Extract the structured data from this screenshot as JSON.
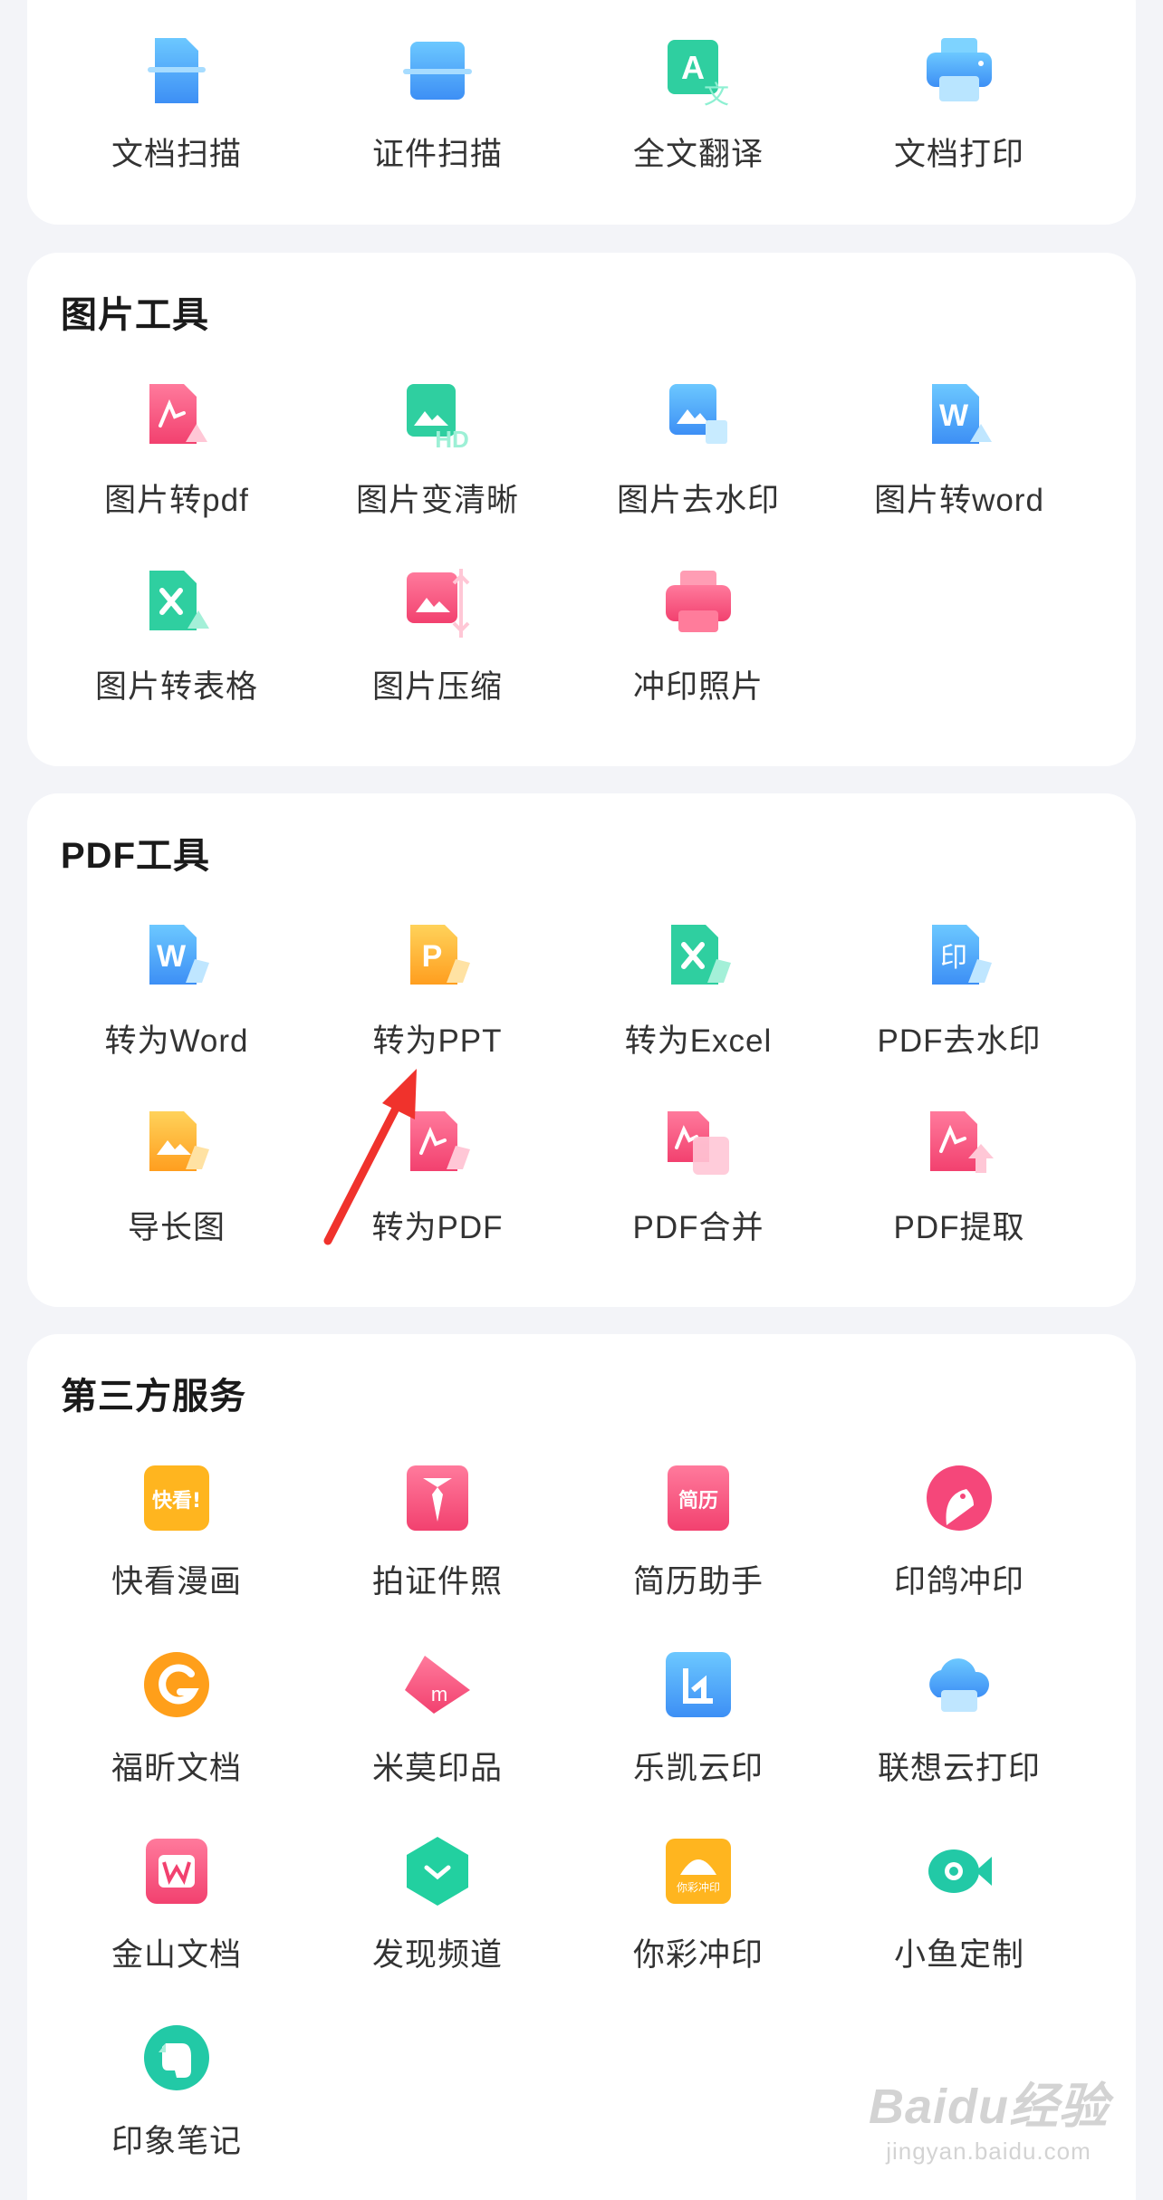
{
  "colors": {
    "page_bg": "#f3f4f8",
    "card_bg": "#ffffff",
    "annotation_arrow": "#f0322c"
  },
  "top_tools": [
    {
      "label": "文档扫描",
      "icon": "document-scan-icon"
    },
    {
      "label": "证件扫描",
      "icon": "id-scan-icon"
    },
    {
      "label": "全文翻译",
      "icon": "translate-icon"
    },
    {
      "label": "文档打印",
      "icon": "printer-icon"
    }
  ],
  "image_tools": {
    "title": "图片工具",
    "items": [
      {
        "label": "图片转pdf",
        "icon": "image-to-pdf-icon"
      },
      {
        "label": "图片变清晰",
        "icon": "image-hd-icon"
      },
      {
        "label": "图片去水印",
        "icon": "image-remove-watermark-icon"
      },
      {
        "label": "图片转word",
        "icon": "image-to-word-icon"
      },
      {
        "label": "图片转表格",
        "icon": "image-to-excel-icon"
      },
      {
        "label": "图片压缩",
        "icon": "image-compress-icon"
      },
      {
        "label": "冲印照片",
        "icon": "photo-print-icon"
      }
    ]
  },
  "pdf_tools": {
    "title": "PDF工具",
    "items": [
      {
        "label": "转为Word",
        "icon": "pdf-to-word-icon"
      },
      {
        "label": "转为PPT",
        "icon": "pdf-to-ppt-icon"
      },
      {
        "label": "转为Excel",
        "icon": "pdf-to-excel-icon"
      },
      {
        "label": "PDF去水印",
        "icon": "pdf-remove-watermark-icon"
      },
      {
        "label": "导长图",
        "icon": "export-long-image-icon"
      },
      {
        "label": "转为PDF",
        "icon": "convert-to-pdf-icon"
      },
      {
        "label": "PDF合并",
        "icon": "pdf-merge-icon"
      },
      {
        "label": "PDF提取",
        "icon": "pdf-extract-icon"
      }
    ]
  },
  "third_party": {
    "title": "第三方服务",
    "items": [
      {
        "label": "快看漫画",
        "icon": "kuaikan-comic-icon",
        "badge": "快看!"
      },
      {
        "label": "拍证件照",
        "icon": "id-photo-icon"
      },
      {
        "label": "简历助手",
        "icon": "resume-icon",
        "badge": "简历"
      },
      {
        "label": "印鸽冲印",
        "icon": "yinge-print-icon"
      },
      {
        "label": "福昕文档",
        "icon": "foxit-icon"
      },
      {
        "label": "米莫印品",
        "icon": "mimo-print-icon"
      },
      {
        "label": "乐凯云印",
        "icon": "lucky-cloud-print-icon"
      },
      {
        "label": "联想云打印",
        "icon": "lenovo-cloud-print-icon"
      },
      {
        "label": "金山文档",
        "icon": "kingsoft-docs-icon"
      },
      {
        "label": "发现频道",
        "icon": "discover-channel-icon"
      },
      {
        "label": "你彩冲印",
        "icon": "nicai-print-icon",
        "badge": "你彩冲印"
      },
      {
        "label": "小鱼定制",
        "icon": "fish-custom-icon"
      },
      {
        "label": "印象笔记",
        "icon": "evernote-icon"
      }
    ]
  },
  "watermark": {
    "logo": "Baidu经验",
    "url": "jingyan.baidu.com"
  }
}
